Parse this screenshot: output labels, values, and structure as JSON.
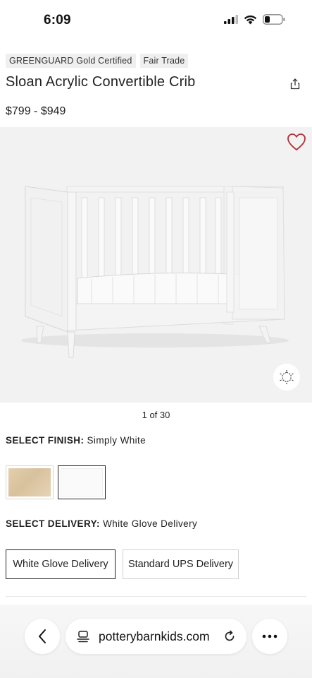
{
  "status": {
    "time": "6:09"
  },
  "badges": [
    "GREENGUARD Gold Certified",
    "Fair Trade"
  ],
  "product": {
    "title": "Sloan Acrylic Convertible Crib",
    "price": "$799 - $949"
  },
  "gallery": {
    "counter": "1 of 30"
  },
  "finish": {
    "label": "SELECT FINISH:",
    "value": "Simply White",
    "swatches": [
      "natural-wood",
      "simply-white"
    ],
    "selected": "simply-white"
  },
  "delivery": {
    "label": "SELECT DELIVERY:",
    "value": "White Glove Delivery",
    "options": [
      "White Glove Delivery",
      "Standard UPS Delivery"
    ],
    "selected": "White Glove Delivery"
  },
  "browser": {
    "url": "potterybarnkids.com"
  },
  "icons": {
    "share": "share-icon",
    "favorite": "heart-icon",
    "view_3d": "3d-view-icon",
    "back": "chevron-left-icon",
    "tabs": "tabs-icon",
    "reload": "reload-icon",
    "more": "more-icon"
  },
  "colors": {
    "favorite": "#b0303a",
    "text": "#222222",
    "image_bg": "#f2f2f2"
  }
}
